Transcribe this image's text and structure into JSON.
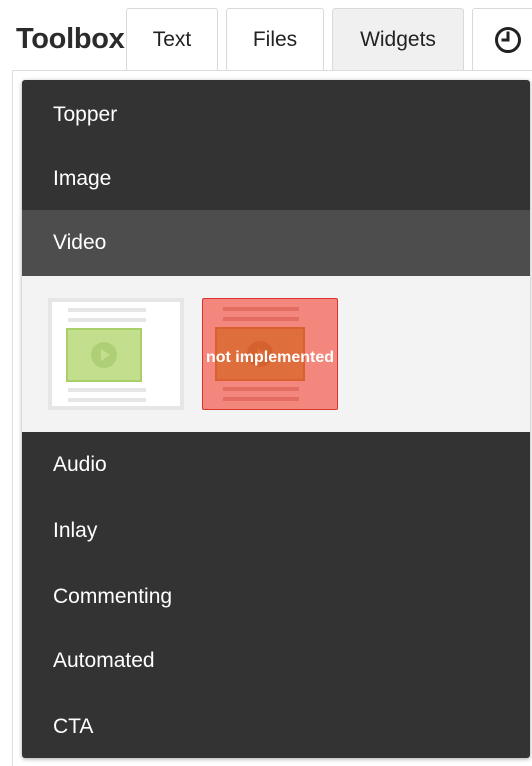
{
  "header": {
    "title": "Toolbox",
    "tabs": [
      {
        "label": "Text"
      },
      {
        "label": "Files"
      },
      {
        "label": "Widgets",
        "active": true
      },
      {
        "icon": "clock-icon"
      }
    ]
  },
  "widgets": {
    "items_top": [
      {
        "label": "Topper"
      },
      {
        "label": "Image"
      },
      {
        "label": "Video",
        "selected": true
      }
    ],
    "video_options": {
      "unavailable_label": "not implemented"
    },
    "items_bottom": [
      {
        "label": "Audio"
      },
      {
        "label": "Inlay"
      },
      {
        "label": "Commenting"
      },
      {
        "label": "Automated"
      },
      {
        "label": "CTA"
      }
    ]
  },
  "colors": {
    "list_bg": "#333333",
    "selected_bg": "#4d4d4d",
    "video_preview_green": "#c3de8d",
    "not_implemented_red": "#f3877d"
  }
}
